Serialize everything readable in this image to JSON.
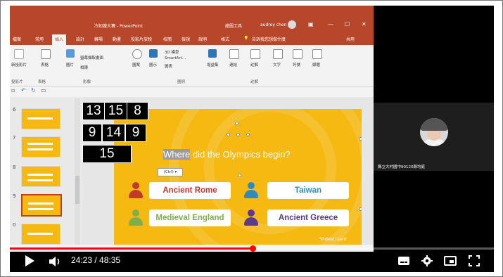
{
  "ppt": {
    "title": "冷知識大賽 - PowerPoint",
    "drawing_tools": "繪圖工具",
    "user_name": "audrey chen",
    "tabs": [
      "檔案",
      "常用",
      "插入",
      "設計",
      "轉場",
      "動畫",
      "投影片放映",
      "校閱",
      "檢視",
      "說明",
      "格式"
    ],
    "active_tab": "插入",
    "search_hint": "告訴我您想做什麼",
    "share": "共用",
    "ribbon": {
      "new_slide": "新投影片",
      "table": "表格",
      "images": "圖片",
      "screenshot": "螢幕擷取畫面",
      "album": "相簿",
      "shapes": "圖案",
      "icons": "圖示",
      "model_3d": "3D 模型",
      "smartart": "SmartArt...",
      "chart": "圖表",
      "addins": "增益集",
      "link": "連結",
      "comment": "註解",
      "text": "文字",
      "symbols": "符號",
      "media": "媒體",
      "groups": [
        "投影片",
        "表格",
        "影像",
        "圖例",
        "註解"
      ]
    },
    "slide_numbers": [
      "6",
      "7",
      "8",
      "9",
      "0"
    ],
    "selected_slide": "9",
    "number_boxes": [
      "13",
      "15",
      "8",
      "9",
      "14",
      "9",
      "15"
    ],
    "question_highlight": "Where",
    "question_rest": " did the Olympics begin?",
    "ctrl_tag": "(Ctrl) ▾",
    "answers": [
      {
        "label": "Ancient Rome",
        "color": "#c0392b"
      },
      {
        "label": "Taiwan",
        "color": "#2e8bc0"
      },
      {
        "label": "Medieval England",
        "color": "#7fae4a"
      },
      {
        "label": "Ancient Greece",
        "color": "#5b3a8c"
      }
    ],
    "logo": "SlidesLizard"
  },
  "webcam": {
    "participant_name": "縣立大村國中90120鄭均庭"
  },
  "player": {
    "time": "24:23 / 48:35",
    "progress": 0.502
  },
  "colors": {
    "ppt_accent": "#b7472a",
    "slide_bg": "#f5b912",
    "youtube_red": "#ff0000"
  }
}
